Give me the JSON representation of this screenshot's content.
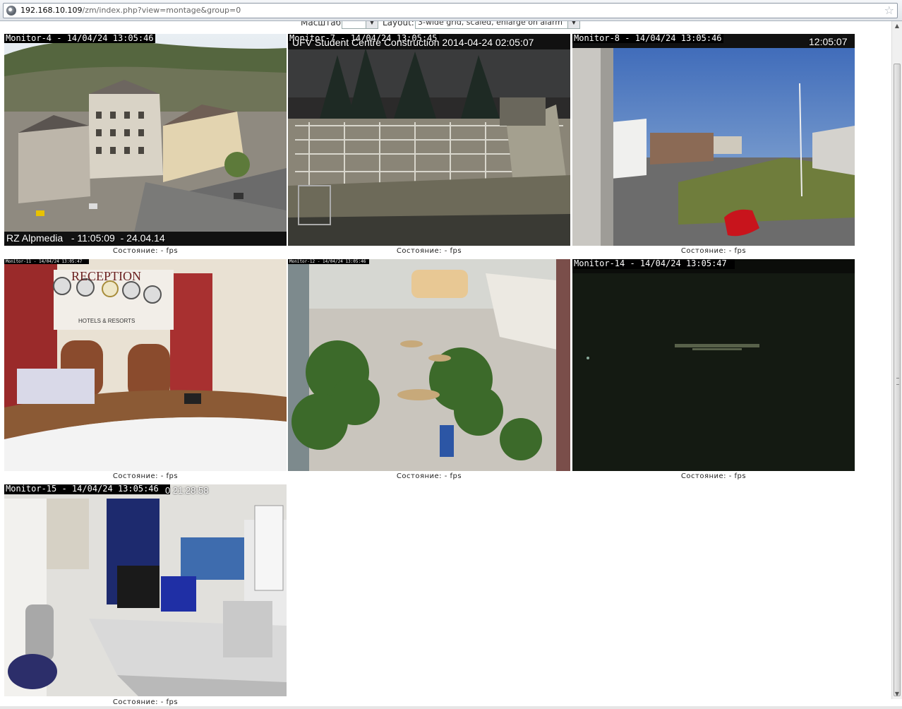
{
  "browser": {
    "url_host": "192.168.10.109",
    "url_path": "/zm/index.php?view=montage&group=0",
    "site_icon": "globe-icon",
    "bookmark_icon": "star-icon"
  },
  "controls": {
    "scale_label": "Масштаб:",
    "scale_value": "",
    "layout_label": "Layout:",
    "layout_value": "3-wide grid, scaled, enlarge on alarm"
  },
  "monitors": [
    {
      "osd": "Monitor-4 - 14/04/24 13:05:46",
      "overlay_bottom": "RZ Alpmedia   - 11:05:09  - 24.04.14",
      "status": "Состояние:  -  fps"
    },
    {
      "osd": "Monitor-7 - 14/04/24 13:05:45",
      "overlay_top": "UFV Student Centre Construction 2014-04-24 02:05:07",
      "status": "Состояние:  -  fps"
    },
    {
      "osd": "Monitor-8 - 14/04/24 13:05:46",
      "overlay_top": "12:05:07",
      "status": "Состояние:  -  fps"
    },
    {
      "osd": "Monitor-11 - 14/04/24 13:05:47",
      "overlay_top": "RECEPTION",
      "sign": "HOTELS & RESORTS",
      "status": "Состояние:  -  fps"
    },
    {
      "osd": "Monitor-12 - 14/04/24 13:05:46",
      "status": "Состояние:  -  fps"
    },
    {
      "osd": "Monitor-14 - 14/04/24 13:05:47",
      "status": "Состояние:  -  fps"
    },
    {
      "osd": "Monitor-15 - 14/04/24 13:05:46",
      "overlay_top": "0 21:28:58",
      "status": "Состояние:  -  fps"
    }
  ]
}
